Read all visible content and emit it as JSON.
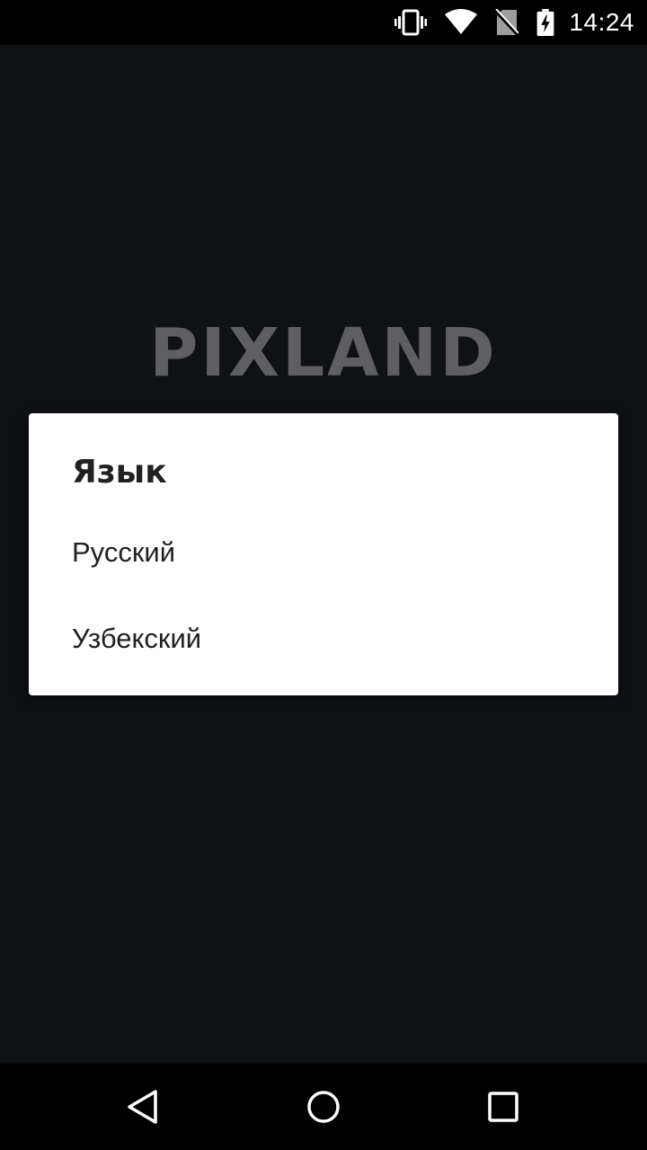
{
  "status_bar": {
    "time": "14:24",
    "icons": [
      "vibrate-icon",
      "wifi-icon",
      "no-sim-icon",
      "battery-charging-icon"
    ]
  },
  "app": {
    "logo_text": "PIXLAND",
    "logo_color": "#5f5f61",
    "background_color": "#0f1114"
  },
  "dialog": {
    "title": "Язык",
    "options": [
      {
        "label": "Русский"
      },
      {
        "label": "Узбекский"
      }
    ]
  },
  "nav_bar": {
    "buttons": [
      "back-icon",
      "home-icon",
      "recents-icon"
    ]
  }
}
